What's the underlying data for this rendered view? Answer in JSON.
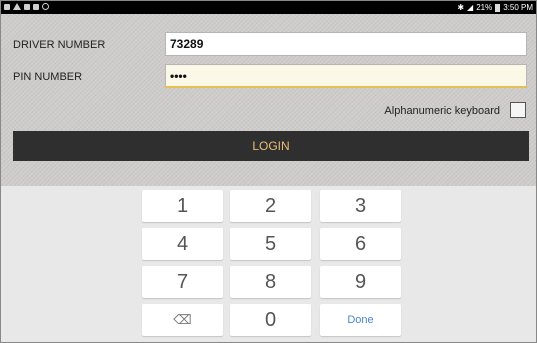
{
  "status_bar": {
    "battery": "21%",
    "time": "3:50 PM",
    "icons": [
      "notification-icon",
      "warning-icon",
      "email-icon",
      "image-icon",
      "cast-icon",
      "bluetooth-icon",
      "signal-icon",
      "battery-icon"
    ]
  },
  "form": {
    "driver_label": "DRIVER NUMBER",
    "driver_value": "73289",
    "pin_label": "PIN NUMBER",
    "pin_value": "••••",
    "alphanumeric_label": "Alphanumeric keyboard",
    "alphanumeric_checked": false,
    "login_label": "LOGIN",
    "login_text_color": "#e8c078"
  },
  "keyboard": {
    "keys": [
      "1",
      "2",
      "3",
      "4",
      "5",
      "6",
      "7",
      "8",
      "9",
      "⌫",
      "0",
      "Done"
    ],
    "done_color": "#4a86c7"
  }
}
